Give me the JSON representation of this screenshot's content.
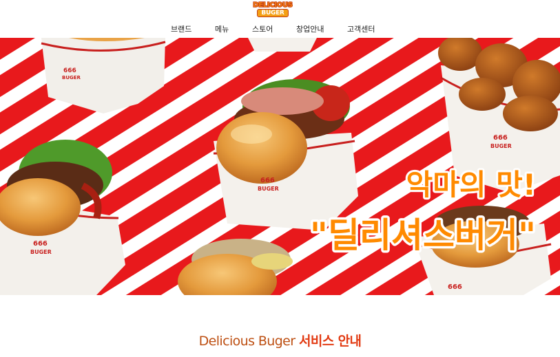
{
  "header": {
    "logo": {
      "line1": "DELICIOUS",
      "line2": "BUGER"
    },
    "nav": [
      {
        "label": "브랜드"
      },
      {
        "label": "메뉴"
      },
      {
        "label": "스토어"
      },
      {
        "label": "창업안내"
      },
      {
        "label": "고객센터"
      }
    ]
  },
  "hero": {
    "headline_line1": "악마의 맛!",
    "headline_line2": "\"딜리셔스버거\"",
    "box_print": {
      "number": "666",
      "word": "BUGER"
    },
    "colors": {
      "stripe_red": "#e8191c",
      "stripe_white": "#ffffff",
      "headline_fill": "#ff8a00",
      "headline_stroke": "#ffffff",
      "box_logo": "#c8201e"
    }
  },
  "section": {
    "title_en": "Delicious Buger",
    "title_ko": "서비스 안내"
  }
}
